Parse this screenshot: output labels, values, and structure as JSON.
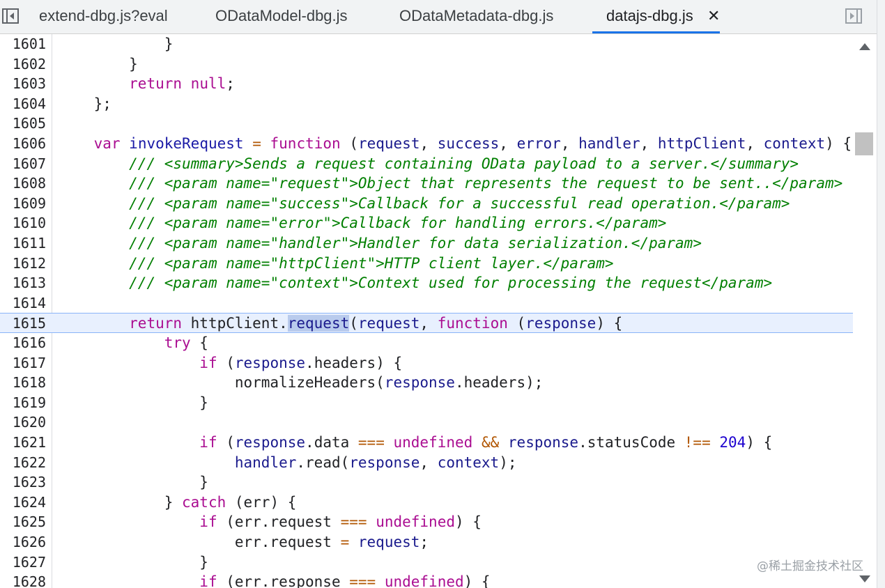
{
  "tabs": [
    {
      "label": "extend-dbg.js?eval",
      "active": false
    },
    {
      "label": "OData​Model-dbg.js",
      "active": false
    },
    {
      "label": "OData​Metadata-dbg.js",
      "active": false
    },
    {
      "label": "datajs-dbg.js",
      "active": true
    }
  ],
  "tab_close_glyph": "✕",
  "icons": {
    "left": "toggle-navigator-icon",
    "right": "toggle-debugger-icon",
    "close": "close-icon"
  },
  "editor": {
    "highlighted_line": "1615",
    "selected_token": "request",
    "lines": [
      {
        "n": "1601",
        "t": [
          [
            "pl",
            "            }"
          ]
        ]
      },
      {
        "n": "1602",
        "t": [
          [
            "pl",
            "        }"
          ]
        ]
      },
      {
        "n": "1603",
        "t": [
          [
            "pl",
            "        "
          ],
          [
            "kw",
            "return"
          ],
          [
            "pl",
            " "
          ],
          [
            "kw",
            "null"
          ],
          [
            "pl",
            ";"
          ]
        ]
      },
      {
        "n": "1604",
        "t": [
          [
            "pl",
            "    };"
          ]
        ]
      },
      {
        "n": "1605",
        "t": []
      },
      {
        "n": "1606",
        "t": [
          [
            "pl",
            "    "
          ],
          [
            "kw",
            "var"
          ],
          [
            "pl",
            " "
          ],
          [
            "fn",
            "invokeRequest"
          ],
          [
            "pl",
            " "
          ],
          [
            "op",
            "="
          ],
          [
            "pl",
            " "
          ],
          [
            "kw",
            "function"
          ],
          [
            "pl",
            " ("
          ],
          [
            "id",
            "request"
          ],
          [
            "pl",
            ", "
          ],
          [
            "id",
            "success"
          ],
          [
            "pl",
            ", "
          ],
          [
            "id",
            "error"
          ],
          [
            "pl",
            ", "
          ],
          [
            "id",
            "handler"
          ],
          [
            "pl",
            ", "
          ],
          [
            "id",
            "httpClient"
          ],
          [
            "pl",
            ", "
          ],
          [
            "id",
            "context"
          ],
          [
            "pl",
            ") {"
          ]
        ]
      },
      {
        "n": "1607",
        "t": [
          [
            "pl",
            "        "
          ],
          [
            "cm",
            "/// <summary>Sends a request containing OData payload to a server.</summary>"
          ]
        ]
      },
      {
        "n": "1608",
        "t": [
          [
            "pl",
            "        "
          ],
          [
            "cm",
            "/// <param name=\"request\">Object that represents the request to be sent..</param>"
          ]
        ]
      },
      {
        "n": "1609",
        "t": [
          [
            "pl",
            "        "
          ],
          [
            "cm",
            "/// <param name=\"success\">Callback for a successful read operation.</param>"
          ]
        ]
      },
      {
        "n": "1610",
        "t": [
          [
            "pl",
            "        "
          ],
          [
            "cm",
            "/// <param name=\"error\">Callback for handling errors.</param>"
          ]
        ]
      },
      {
        "n": "1611",
        "t": [
          [
            "pl",
            "        "
          ],
          [
            "cm",
            "/// <param name=\"handler\">Handler for data serialization.</param>"
          ]
        ]
      },
      {
        "n": "1612",
        "t": [
          [
            "pl",
            "        "
          ],
          [
            "cm",
            "/// <param name=\"httpClient\">HTTP client layer.</param>"
          ]
        ]
      },
      {
        "n": "1613",
        "t": [
          [
            "pl",
            "        "
          ],
          [
            "cm",
            "/// <param name=\"context\">Context used for processing the request</param>"
          ]
        ]
      },
      {
        "n": "1614",
        "t": []
      },
      {
        "n": "1615",
        "t": [
          [
            "pl",
            "        "
          ],
          [
            "kw",
            "return"
          ],
          [
            "pl",
            " httpClient."
          ],
          [
            "sel",
            "request"
          ],
          [
            "pl",
            "("
          ],
          [
            "id",
            "request"
          ],
          [
            "pl",
            ", "
          ],
          [
            "kw",
            "function"
          ],
          [
            "pl",
            " ("
          ],
          [
            "id",
            "response"
          ],
          [
            "pl",
            ") {"
          ]
        ]
      },
      {
        "n": "1616",
        "t": [
          [
            "pl",
            "            "
          ],
          [
            "kw",
            "try"
          ],
          [
            "pl",
            " {"
          ]
        ]
      },
      {
        "n": "1617",
        "t": [
          [
            "pl",
            "                "
          ],
          [
            "kw",
            "if"
          ],
          [
            "pl",
            " ("
          ],
          [
            "id",
            "response"
          ],
          [
            "pl",
            ".headers) {"
          ]
        ]
      },
      {
        "n": "1618",
        "t": [
          [
            "pl",
            "                    normalizeHeaders("
          ],
          [
            "id",
            "response"
          ],
          [
            "pl",
            ".headers);"
          ]
        ]
      },
      {
        "n": "1619",
        "t": [
          [
            "pl",
            "                }"
          ]
        ]
      },
      {
        "n": "1620",
        "t": []
      },
      {
        "n": "1621",
        "t": [
          [
            "pl",
            "                "
          ],
          [
            "kw",
            "if"
          ],
          [
            "pl",
            " ("
          ],
          [
            "id",
            "response"
          ],
          [
            "pl",
            ".data "
          ],
          [
            "op",
            "==="
          ],
          [
            "pl",
            " "
          ],
          [
            "kw",
            "undefined"
          ],
          [
            "pl",
            " "
          ],
          [
            "op",
            "&&"
          ],
          [
            "pl",
            " "
          ],
          [
            "id",
            "response"
          ],
          [
            "pl",
            ".statusCode "
          ],
          [
            "op",
            "!=="
          ],
          [
            "pl",
            " "
          ],
          [
            "num",
            "204"
          ],
          [
            "pl",
            ") {"
          ]
        ]
      },
      {
        "n": "1622",
        "t": [
          [
            "pl",
            "                    "
          ],
          [
            "id",
            "handler"
          ],
          [
            "pl",
            ".read("
          ],
          [
            "id",
            "response"
          ],
          [
            "pl",
            ", "
          ],
          [
            "id",
            "context"
          ],
          [
            "pl",
            ");"
          ]
        ]
      },
      {
        "n": "1623",
        "t": [
          [
            "pl",
            "                }"
          ]
        ]
      },
      {
        "n": "1624",
        "t": [
          [
            "pl",
            "            } "
          ],
          [
            "kw",
            "catch"
          ],
          [
            "pl",
            " (err) {"
          ]
        ]
      },
      {
        "n": "1625",
        "t": [
          [
            "pl",
            "                "
          ],
          [
            "kw",
            "if"
          ],
          [
            "pl",
            " (err.request "
          ],
          [
            "op",
            "==="
          ],
          [
            "pl",
            " "
          ],
          [
            "kw",
            "undefined"
          ],
          [
            "pl",
            ") {"
          ]
        ]
      },
      {
        "n": "1626",
        "t": [
          [
            "pl",
            "                    err.request "
          ],
          [
            "op",
            "="
          ],
          [
            "pl",
            " "
          ],
          [
            "id",
            "request"
          ],
          [
            "pl",
            ";"
          ]
        ]
      },
      {
        "n": "1627",
        "t": [
          [
            "pl",
            "                }"
          ]
        ]
      },
      {
        "n": "1628",
        "t": [
          [
            "pl",
            "                "
          ],
          [
            "kw",
            "if"
          ],
          [
            "pl",
            " (err.response "
          ],
          [
            "op",
            "==="
          ],
          [
            "pl",
            " "
          ],
          [
            "kw",
            "undefined"
          ],
          [
            "pl",
            ") {"
          ]
        ]
      }
    ]
  },
  "watermark": "@稀土掘金技术社区"
}
